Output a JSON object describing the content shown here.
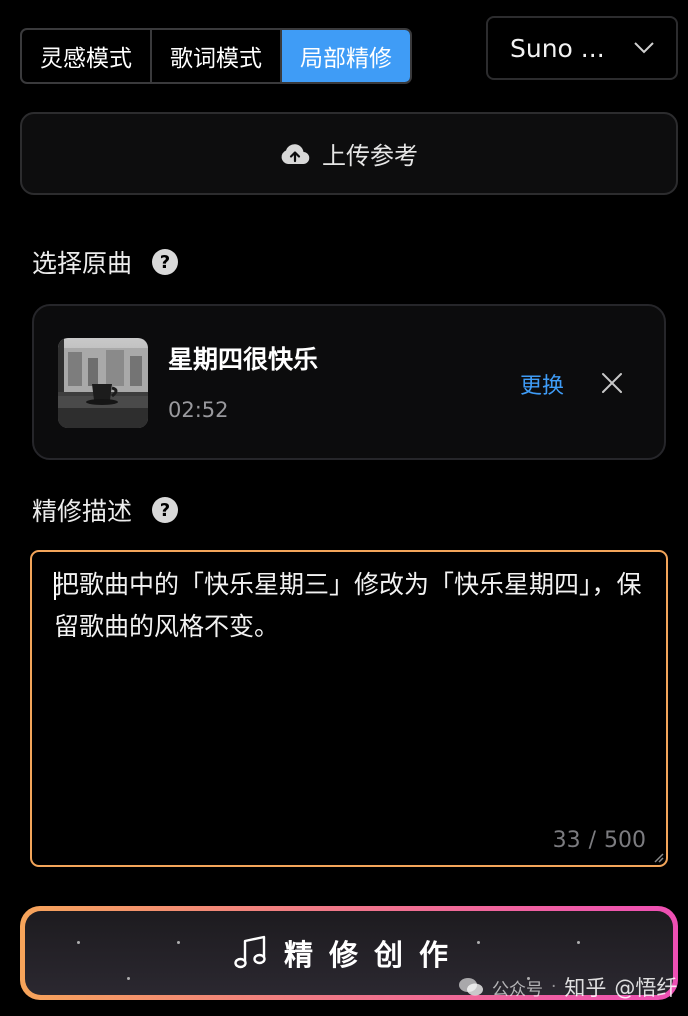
{
  "mode_tabs": [
    {
      "label": "灵感模式",
      "active": false
    },
    {
      "label": "歌词模式",
      "active": false
    },
    {
      "label": "局部精修",
      "active": true
    }
  ],
  "model_select": {
    "value": "Suno ..."
  },
  "upload": {
    "label": "上传参考",
    "icon": "cloud-upload-icon"
  },
  "original_song_section": {
    "title": "选择原曲",
    "help_icon": "question-circle-icon"
  },
  "song": {
    "title": "星期四很快乐",
    "duration": "02:52",
    "replace_label": "更换",
    "remove_icon": "close-icon"
  },
  "description_section": {
    "title": "精修描述",
    "help_icon": "question-circle-icon"
  },
  "description": {
    "text": "把歌曲中的「快乐星期三」修改为「快乐星期四」，保留歌曲的风格不变。",
    "count": "33",
    "separator": "/",
    "max": "500"
  },
  "create_button": {
    "label": "精修创作",
    "icon": "music-note-icon"
  },
  "watermark": {
    "source": "公众号",
    "site": "知乎",
    "author": "@悟纤"
  },
  "colors": {
    "accent_blue": "#3f9cf6",
    "focus_border": "#f3a55a",
    "gradient_start": "#f6a45a",
    "gradient_end": "#ee4fb4",
    "background": "#000000"
  }
}
